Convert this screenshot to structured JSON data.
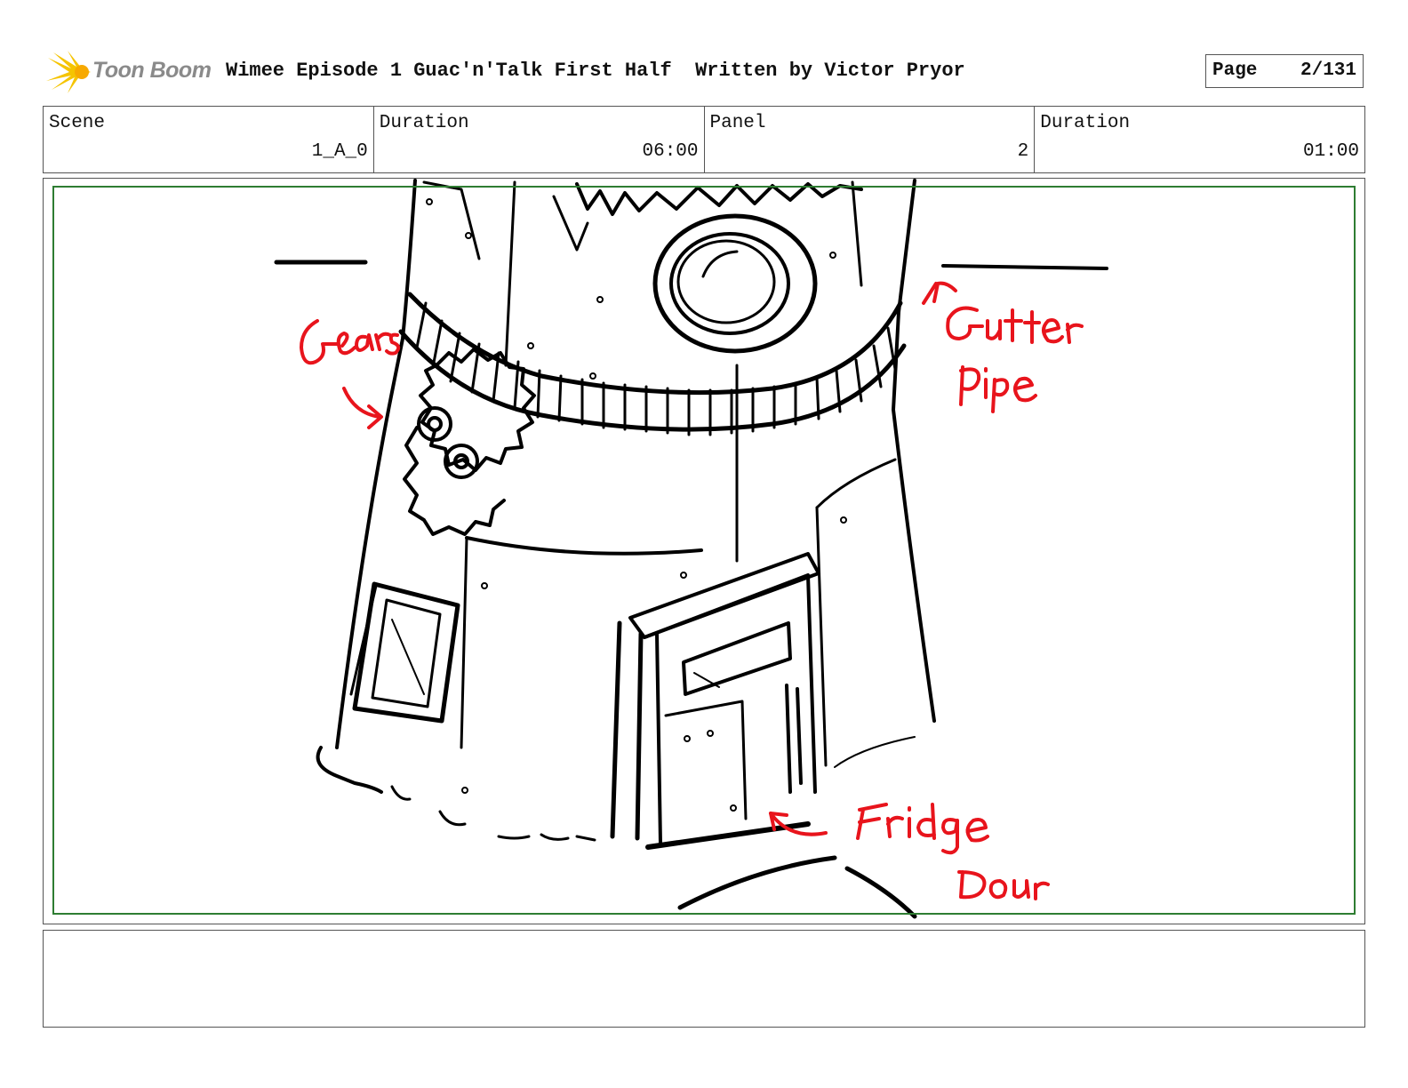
{
  "brand": {
    "name": "Toon Boom",
    "accent": "#f5c400"
  },
  "header": {
    "title": "Wimee Episode 1 Guac'n'Talk First Half  Written by Victor Pryor",
    "page_label": "Page",
    "page_value": "2/131"
  },
  "info": {
    "scene_label": "Scene",
    "scene_value": "1_A_0",
    "scene_duration_label": "Duration",
    "scene_duration_value": "06:00",
    "panel_label": "Panel",
    "panel_value": "2",
    "panel_duration_label": "Duration",
    "panel_duration_value": "01:00"
  },
  "panel": {
    "annotations": [
      "Gears",
      "Gutter Pipe",
      "Fridge Door"
    ],
    "annotation_color": "#e8141c",
    "safe_frame_color": "#2e7d32"
  },
  "notes": {
    "text": ""
  }
}
